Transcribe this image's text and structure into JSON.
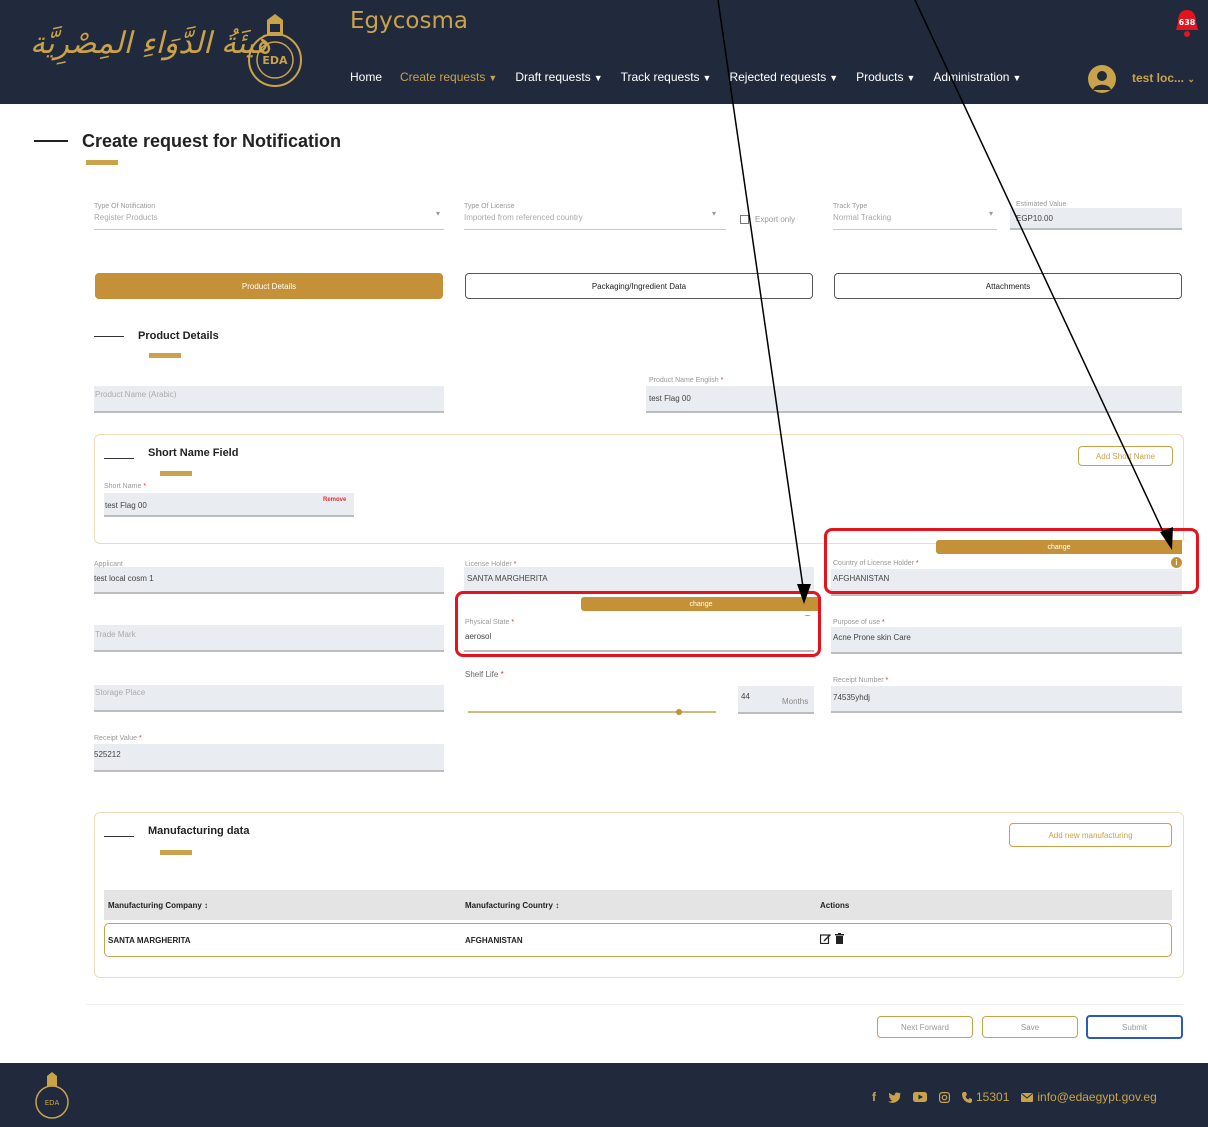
{
  "header": {
    "logo_arabic": "هَيئَةُ الدَّوَاءِ المِصْرِيَّة",
    "seal_text": "EDA",
    "app_title": "Egycosma",
    "nav": [
      {
        "label": "Home",
        "active": false,
        "has_menu": false
      },
      {
        "label": "Create requests",
        "active": true,
        "has_menu": true
      },
      {
        "label": "Draft requests",
        "active": false,
        "has_menu": true
      },
      {
        "label": "Track requests",
        "active": false,
        "has_menu": true
      },
      {
        "label": "Rejected requests",
        "active": false,
        "has_menu": true
      },
      {
        "label": "Products",
        "active": false,
        "has_menu": true
      },
      {
        "label": "Administration",
        "active": false,
        "has_menu": true
      }
    ],
    "notification_count": "638",
    "user_name": "test loc..."
  },
  "page": {
    "title": "Create request for Notification"
  },
  "request_info": {
    "type_of_notification_label": "Type Of Notification",
    "type_of_notification_value": "Register Products",
    "type_of_license_label": "Type Of License",
    "type_of_license_value": "Imported from referenced country",
    "export_only_label": "Export only",
    "track_type_label": "Track Type",
    "track_type_value": "Normal Tracking",
    "estimated_value_label": "Estimated Value",
    "estimated_value": "EGP10.00"
  },
  "tabs": [
    "Product Details",
    "Packaging/Ingredient Data",
    "Attachments"
  ],
  "product_details": {
    "section_title": "Product Details",
    "product_name_arabic_label": "Product Name (Arabic)",
    "product_name_english_label": "Product Name English",
    "product_name_english_value": "test Flag 00",
    "short_name_section_title": "Short Name Field",
    "add_short_name_label": "Add Short Name",
    "short_name_label": "Short Name",
    "short_name_value": "test Flag 00",
    "remove_label": "Remove",
    "applicant_label": "Applicant",
    "applicant_value": "test local cosm 1",
    "license_holder_label": "License Holder",
    "license_holder_value": "SANTA MARGHERITA",
    "country_license_holder_label": "Country of License Holder",
    "country_license_holder_value": "AFGHANISTAN",
    "change_label": "change",
    "change_label_2": "change",
    "info_icon": "i",
    "trade_mark_label": "Trade Mark",
    "physical_state_label": "Physical State",
    "physical_state_value": "aerosol",
    "purpose_of_use_label": "Purpose of use",
    "purpose_of_use_value": "Acne Prone skin Care",
    "storage_place_label": "Storage Place",
    "shelf_life_label": "Shelf Life",
    "shelf_life_value": "44",
    "shelf_life_unit": "Months",
    "shelf_life_fraction": 0.85,
    "receipt_number_label": "Receipt Number",
    "receipt_number_value": "74535yhdj",
    "receipt_value_label": "Receipt Value",
    "receipt_value": "525212"
  },
  "manufacturing": {
    "section_title": "Manufacturing data",
    "add_button_label": "Add new manufacturing",
    "columns": [
      "Manufacturing Company ↕",
      "Manufacturing Country ↕",
      "Actions"
    ],
    "rows": [
      {
        "company": "SANTA MARGHERITA",
        "country": "AFGHANISTAN"
      }
    ]
  },
  "actions": {
    "next_forward": "Next Forward",
    "save": "Save",
    "submit": "Submit"
  },
  "footer": {
    "phone": "15301",
    "email": "info@edaegypt.gov.eg",
    "seal_text": "EDA"
  },
  "colors": {
    "header_bg": "#212a3c",
    "gold": "#c49139",
    "annotation_red": "#e3141d"
  }
}
